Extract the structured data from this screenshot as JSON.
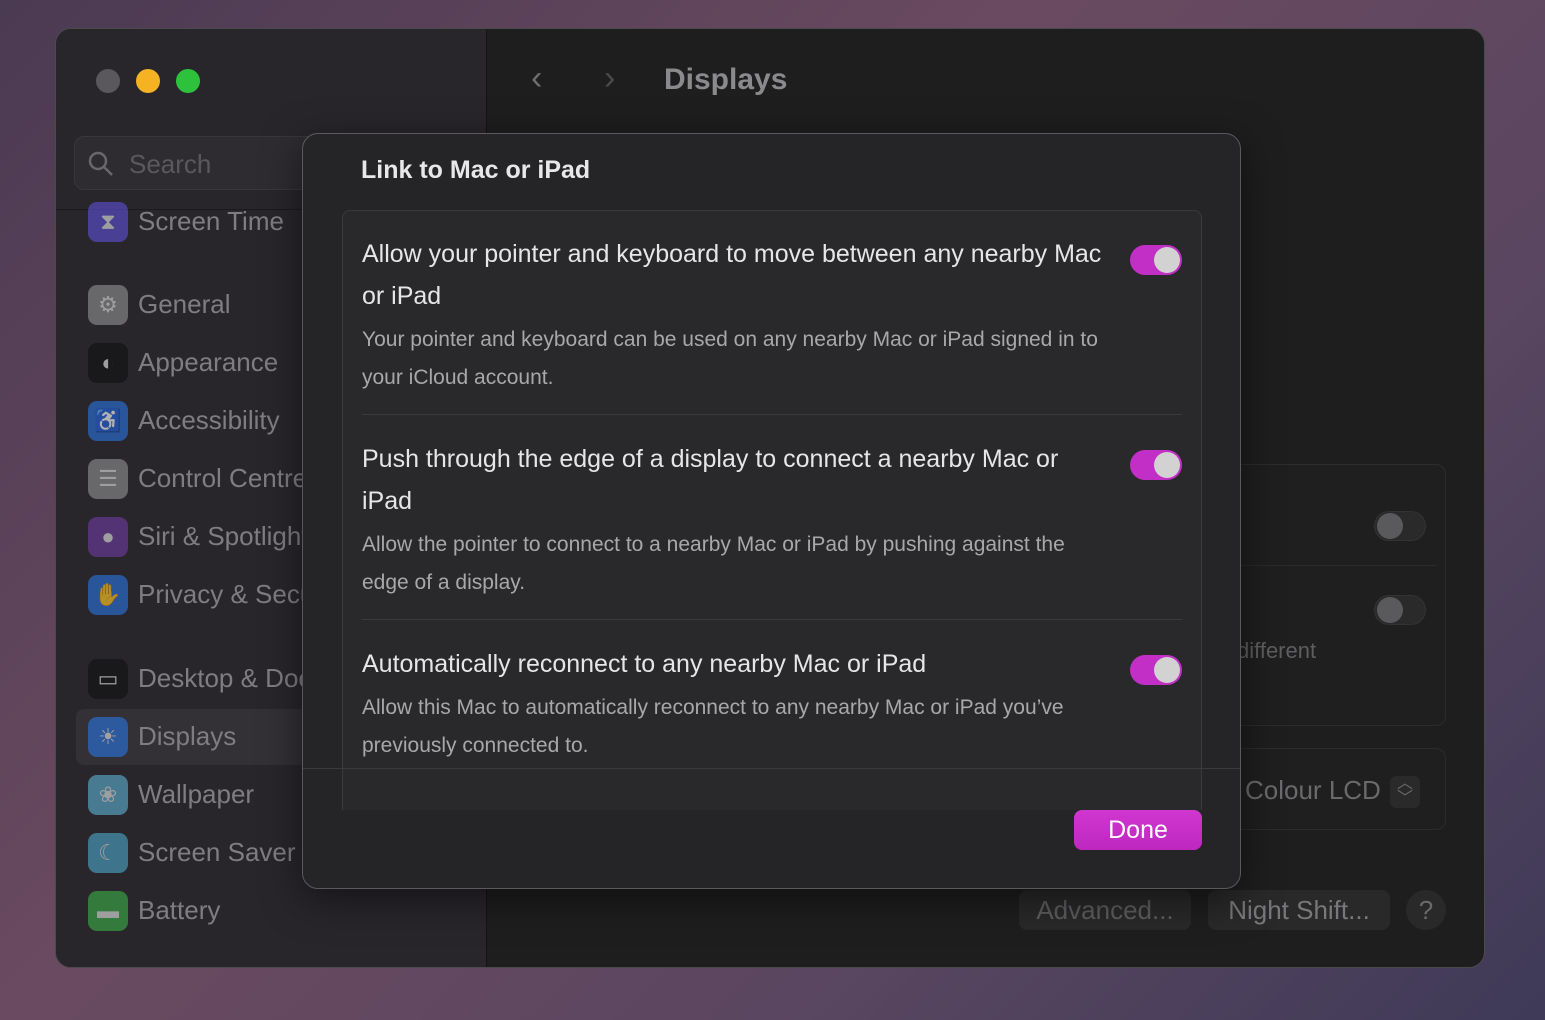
{
  "window": {
    "title": "Displays",
    "back_icon": "chevron-left",
    "forward_icon": "chevron-right"
  },
  "sidebar": {
    "search_placeholder": "Search",
    "items": [
      {
        "label": "Screen Time",
        "icon": "hourglass",
        "color": "#5b4fd0"
      },
      {
        "label": "General",
        "icon": "gear",
        "color": "#8a8a8c"
      },
      {
        "label": "Appearance",
        "icon": "appearance-circle",
        "color": "#111111"
      },
      {
        "label": "Accessibility",
        "icon": "accessibility-figure",
        "color": "#2a6fd6"
      },
      {
        "label": "Control Centre",
        "icon": "toggles",
        "color": "#8a8a8c"
      },
      {
        "label": "Siri & Spotlight",
        "icon": "siri-orb",
        "color": "#6a3a9a"
      },
      {
        "label": "Privacy & Security",
        "icon": "hand",
        "color": "#2a6fd6"
      },
      {
        "label": "Desktop & Dock",
        "icon": "dock",
        "color": "#111111"
      },
      {
        "label": "Displays",
        "icon": "sun",
        "color": "#2a6fd6",
        "selected": true
      },
      {
        "label": "Wallpaper",
        "icon": "flower",
        "color": "#5aa8c8"
      },
      {
        "label": "Screen Saver",
        "icon": "screen-saver",
        "color": "#4aa0c0"
      },
      {
        "label": "Battery",
        "icon": "battery",
        "color": "#3aa848"
      }
    ]
  },
  "background": {
    "partial_text": "different",
    "display_select": "Colour LCD",
    "advanced_label": "Advanced...",
    "night_shift_label": "Night Shift...",
    "help_label": "?",
    "toggles": [
      false,
      false
    ]
  },
  "dialog": {
    "title": "Link to Mac or iPad",
    "done_label": "Done",
    "accent": "#c82fc8",
    "rows": [
      {
        "title": "Allow your pointer and keyboard to move between any nearby Mac or iPad",
        "description": "Your pointer and keyboard can be used on any nearby Mac or iPad signed in to your iCloud account.",
        "enabled": true
      },
      {
        "title": "Push through the edge of a display to connect a nearby Mac or iPad",
        "description": "Allow the pointer to connect to a nearby Mac or iPad by pushing against the edge of a display.",
        "enabled": true
      },
      {
        "title": "Automatically reconnect to any nearby Mac or iPad",
        "description": "Allow this Mac to automatically reconnect to any nearby Mac or iPad you’ve previously connected to.",
        "enabled": true
      }
    ]
  }
}
